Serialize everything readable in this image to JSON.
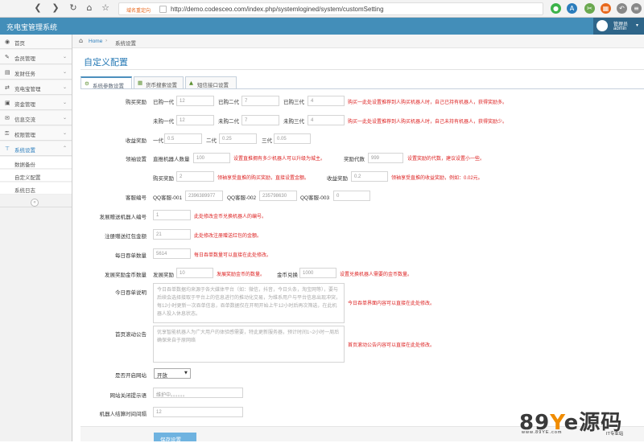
{
  "browser": {
    "warning": "域名重定向",
    "url": "http://demo.codesceo.com/index.php/systemlogined/system/customSetting"
  },
  "header": {
    "brand": "充电宝管理系统",
    "user_name": "管理员",
    "user_role": "admin"
  },
  "sidebar": {
    "items": [
      {
        "label": "首页",
        "icon": "dashboard-icon"
      },
      {
        "label": "会员管理",
        "icon": "edit-icon"
      },
      {
        "label": "发财任务",
        "icon": "list-icon"
      },
      {
        "label": "充电宝管理",
        "icon": "shuffle-icon"
      },
      {
        "label": "资金管理",
        "icon": "money-icon"
      },
      {
        "label": "信息交流",
        "icon": "comments-icon"
      },
      {
        "label": "权限管理",
        "icon": "key-icon"
      },
      {
        "label": "系统设置",
        "icon": "settings-icon"
      }
    ],
    "subitems": [
      "数据备份",
      "自定义配置",
      "系统日志"
    ]
  },
  "breadcrumb": {
    "home": "Home",
    "current": "系统设置"
  },
  "page": {
    "title": "自定义配置"
  },
  "tabs": [
    {
      "label": "系统参数设置",
      "icon": "cog-icon"
    },
    {
      "label": "货币搜索设置",
      "icon": "grid-icon"
    },
    {
      "label": "短信接口设置",
      "icon": "warning-icon"
    }
  ],
  "form": {
    "buy_reward": {
      "label": "购买奖励",
      "row1": {
        "labels": [
          "已购一代",
          "已购二代",
          "已购三代"
        ],
        "values": [
          "12",
          "7",
          "4"
        ],
        "hint": "购买一此处设置推荐到人购买机器人时，自己已持有机器人，获得奖励多。"
      },
      "row2": {
        "labels": [
          "未购一代",
          "未购二代",
          "未购三代"
        ],
        "values": [
          "12",
          "7",
          "4"
        ],
        "hint": "购买一此处设置推荐到人购买机器人时，自己未持有机器人，获得奖励少。"
      }
    },
    "income_reward": {
      "label": "收益奖励",
      "labels": [
        "一代",
        "二代",
        "三代"
      ],
      "values": [
        "0.5",
        "0.25",
        "0.05"
      ]
    },
    "leader_reward": {
      "label": "领袖设置",
      "l1": "直推机器人数量",
      "v1": "100",
      "h1": "设置直推拥有多少机器人可以升级为城主。",
      "l2": "奖励代数",
      "v2": "999",
      "h2": "设置奖励的代数，建议设置小一些。",
      "l3": "购买奖励",
      "v3": "2",
      "h3": "领袖享受直推的购买奖励，直接设置金额。",
      "l4": "收益奖励",
      "v4": "0.2",
      "h4": "领袖享受直推的收益奖励，例如：0.02元。"
    },
    "qq": {
      "label": "客服编号",
      "labels": [
        "QQ客服-001",
        "QQ客服-002",
        "QQ客服-003"
      ],
      "values": [
        "2396389977",
        "235798630",
        "0"
      ]
    },
    "gift_robot": {
      "label": "发展赠送机器人编号",
      "value": "1",
      "hint": "此处修改金币兑换机器人的编号。"
    },
    "reg_gift": {
      "label": "注册赠送红包金额",
      "value": "21",
      "hint": "此处修改注册赠送红包的金额。"
    },
    "daily_orders": {
      "label": "每日吞单数量",
      "value": "5614",
      "hint": "每日吞单数量可以直接在此处修改。"
    },
    "coin_reward": {
      "label": "发展奖励金币数量",
      "l1": "发展奖励",
      "v1": "10",
      "h1": "发展奖励金币的数量。",
      "l2": "金币兑换",
      "v2": "1000",
      "h2": "设置兑换机器人需要的金币数量。"
    },
    "today_desc": {
      "label": "今日吞单说明",
      "text": "今日吞单数据均来源于各大媒体平台（如：微信，抖音，今日头条，淘宝网等），要与后续会选择接取于平台上的信息进行的推动化交易，为维系用户与平台信息出现冲突，每12小时更新一次吞单信息，吞单数据仅在开明开始上午12小时后再次筛选，在此机器人投入休息状态。",
      "hint": "今日吞单界面内容可以直接在此处修改。"
    },
    "notice": {
      "label": "首页滚动公告",
      "text": "优享智能机器人为广大用户的体验感需要，特此更新服务器，预计时间1~2小时一周后确保来自于原网络",
      "hint": "首页滚动公告内容可以直接在此处修改。"
    },
    "site_open": {
      "label": "是否开启网站",
      "value": "开放"
    },
    "close_tip": {
      "label": "网站关闭提示语",
      "placeholder": "维护中。。。。。。"
    },
    "robot_time": {
      "label": "机器人结算时间间隔",
      "value": "12"
    }
  },
  "footer": {
    "save": "保存设置"
  },
  "watermark": {
    "brand_a": "89",
    "brand_b": "Y",
    "brand_c": "e源码",
    "url": "www.89YE.com",
    "tag": "IT专业站"
  }
}
